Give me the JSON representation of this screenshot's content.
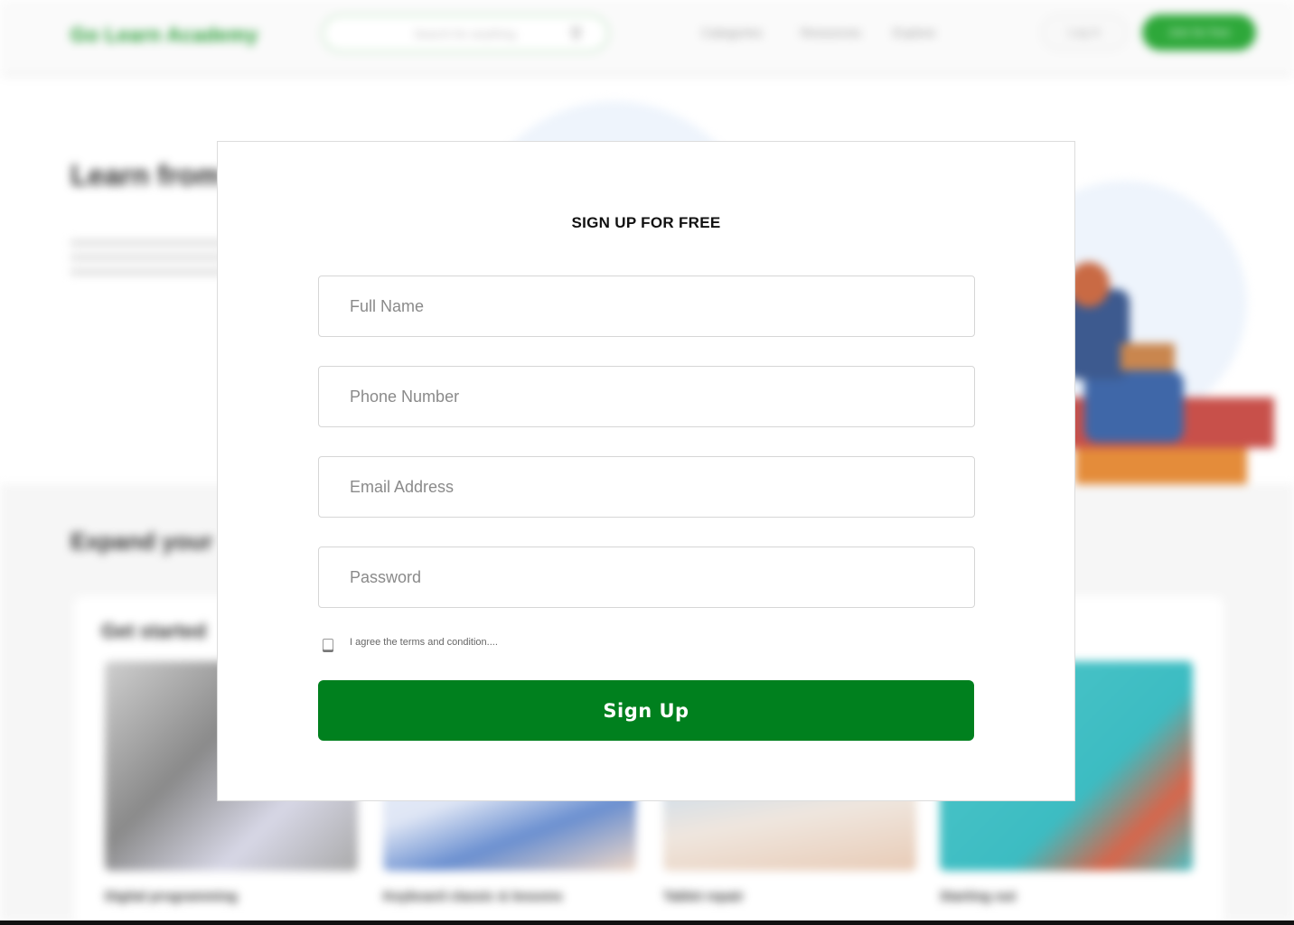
{
  "background": {
    "logo": "Go Learn Academy",
    "search_placeholder": "Search for anything",
    "nav": [
      "Categories",
      "Resources",
      "Explore"
    ],
    "login_label": "Log in",
    "join_label": "Join for free",
    "hero_title": "Learn from an",
    "section_title": "Expand your",
    "card_title": "Get started",
    "courses": [
      "Digital programming",
      "Keyboard classic & lessons",
      "Tablet repair",
      "Starting out"
    ]
  },
  "modal": {
    "title": "SIGN UP FOR FREE",
    "fields": {
      "full_name": "Full Name",
      "phone": "Phone Number",
      "email": "Email Address",
      "password": "Password"
    },
    "terms_label": "I agree the terms and condition....",
    "signup_label": "Sign Up"
  },
  "colors": {
    "primary_green": "#00801e",
    "field_border": "#d6d6d6"
  }
}
